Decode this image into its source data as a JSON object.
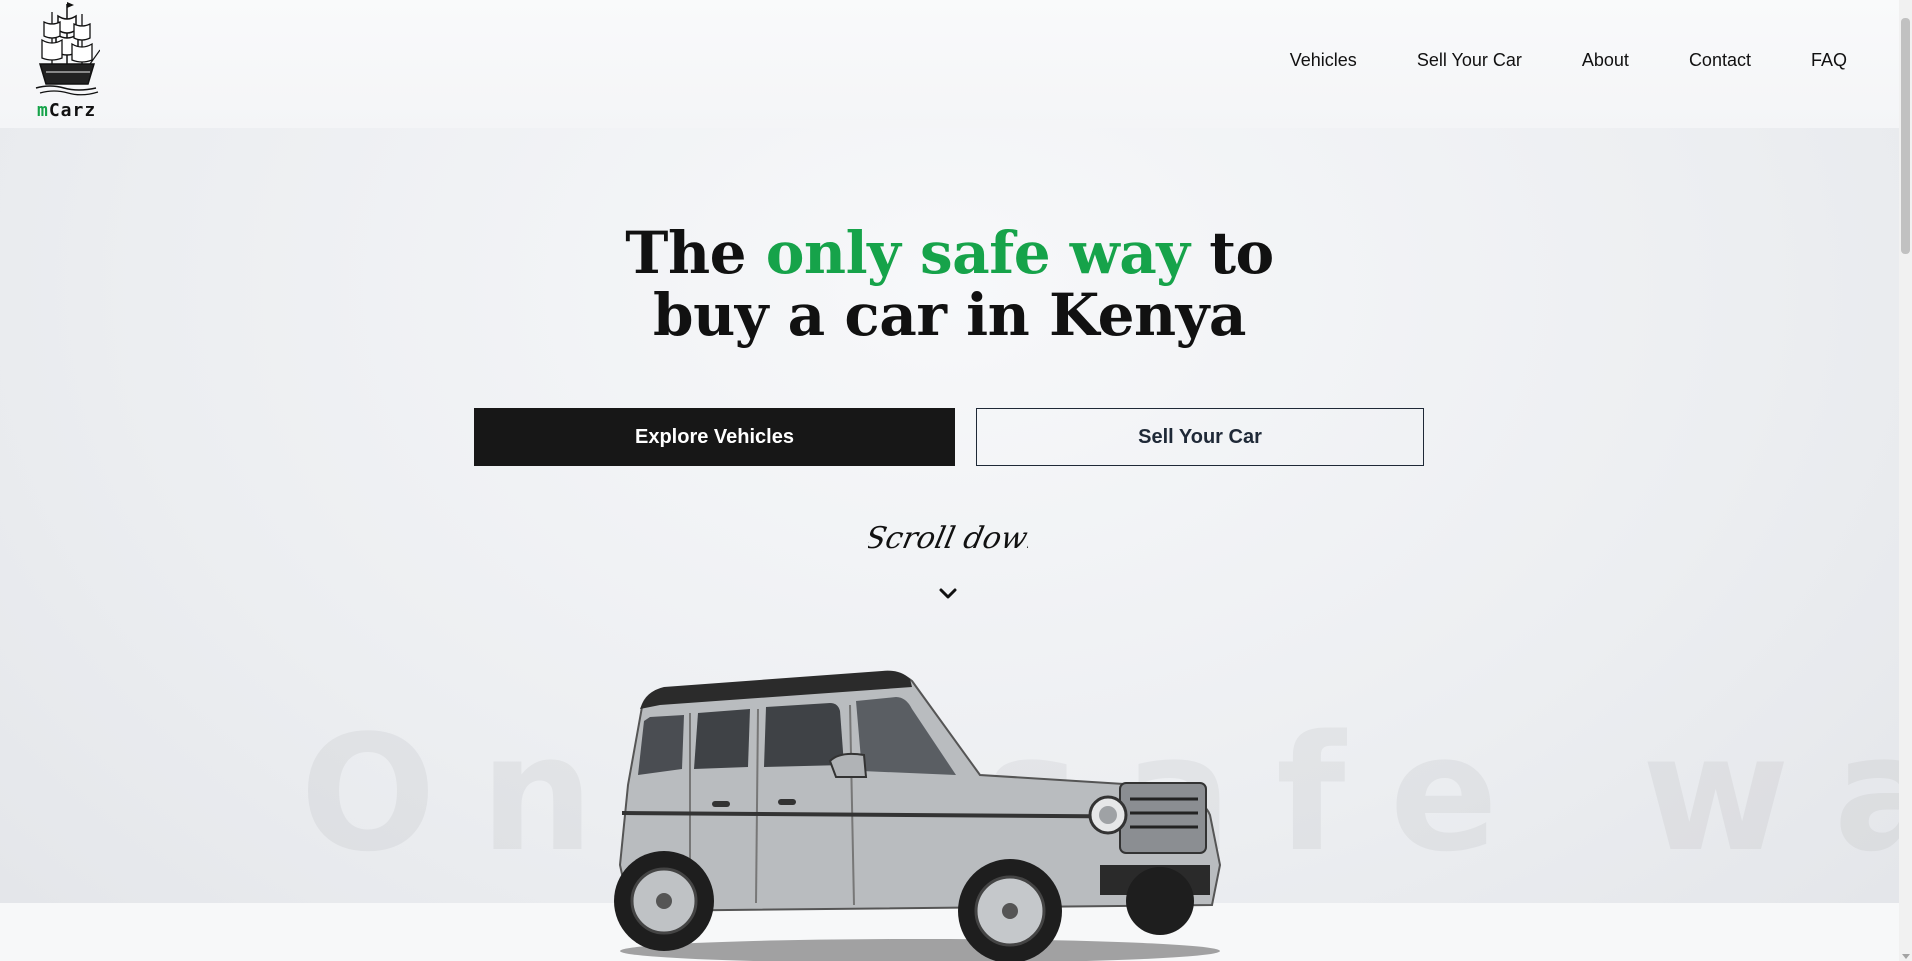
{
  "brand": {
    "prefix": "m",
    "name": "Carz"
  },
  "nav": {
    "items": [
      {
        "label": "Vehicles"
      },
      {
        "label": "Sell Your Car"
      },
      {
        "label": "About"
      },
      {
        "label": "Contact"
      },
      {
        "label": "FAQ"
      }
    ]
  },
  "hero": {
    "title_pre": "The ",
    "title_accent": "only safe way",
    "title_post": " to",
    "title_line2": "buy a car in Kenya",
    "primary_cta": "Explore Vehicles",
    "secondary_cta": "Sell Your Car",
    "scroll_hint": "Scroll down",
    "background_word": "Only safe way"
  },
  "colors": {
    "accent": "#16a34a",
    "primary_button": "#171717"
  },
  "icons": {
    "logo": "ship-icon",
    "scroll": "chevron-down-icon"
  }
}
